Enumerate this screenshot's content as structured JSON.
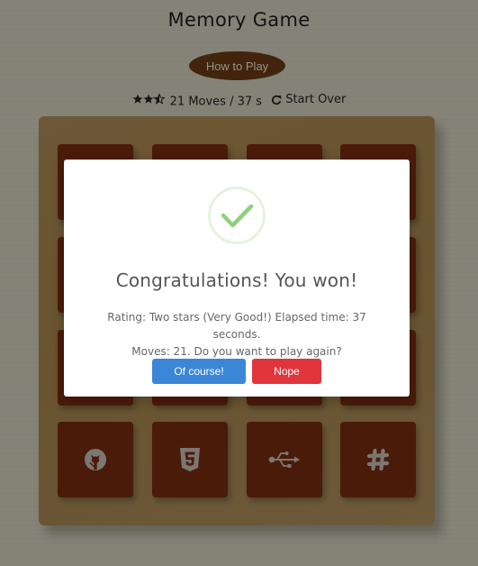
{
  "header": {
    "title": "Memory Game",
    "how_to_play": "How to Play"
  },
  "score_panel": {
    "rating_stars": 2.5,
    "moves_text": "21 Moves / 37 s",
    "restart_label": "Start Over"
  },
  "deck": {
    "columns": 4,
    "rows": 4,
    "visible_bottom_row_icons": [
      "github-icon",
      "html5-icon",
      "usb-icon",
      "slack-icon"
    ]
  },
  "modal": {
    "title": "Congratulations! You won!",
    "message_line1": "Rating: Two stars (Very Good!) Elapsed time: 37 seconds.",
    "message_line2": "Moves: 21. Do you want to play again?",
    "confirm_label": "Of course!",
    "cancel_label": "Nope"
  },
  "colors": {
    "card": "#7a2c10",
    "confirm": "#3b86d6",
    "cancel": "#e0353b",
    "success": "#8fd17a"
  }
}
